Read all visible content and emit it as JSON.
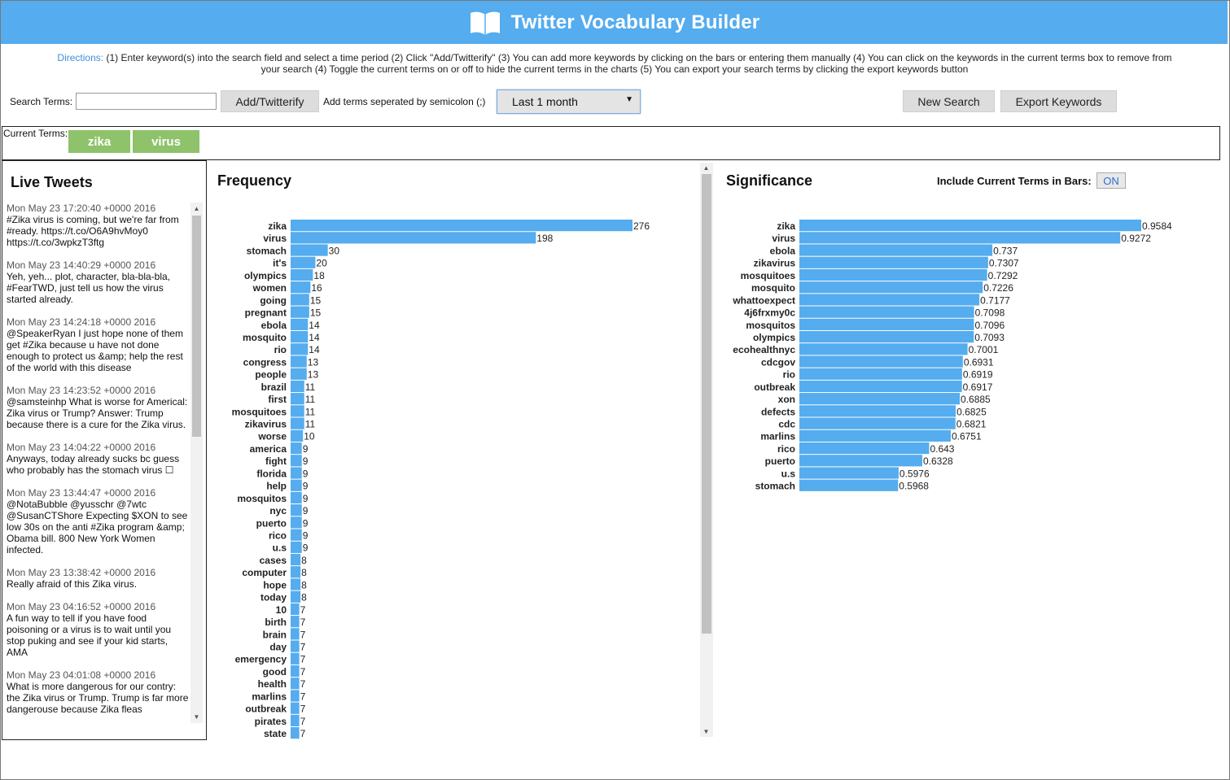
{
  "header": {
    "title": "Twitter Vocabulary Builder",
    "icon": "book-icon"
  },
  "directions": {
    "label": "Directions:",
    "text": " (1) Enter keyword(s) into the search field and select a time period (2) Click \"Add/Twitterify\" (3) You can add more keywords by clicking on the bars or entering them manually (4) You can click on the keywords in the current terms box to remove from your search (4) Toggle the current terms on or off to hide the current terms in the charts (5) You can export your search terms by clicking the export keywords button"
  },
  "search": {
    "label": "Search Terms:",
    "value": "",
    "add_button": "Add/Twitterify",
    "hint": "Add terms seperated by semicolon (;)",
    "period": "Last 1 month",
    "new_search_button": "New Search",
    "export_button": "Export Keywords"
  },
  "current_terms": {
    "label": "Current Terms:",
    "terms": [
      "zika",
      "virus"
    ]
  },
  "live_tweets": {
    "title": "Live Tweets",
    "tweets": [
      {
        "time": "Mon May 23 17:20:40 +0000 2016",
        "text": "#Zika virus is coming, but we're far from #ready. https://t.co/O6A9hvMoy0 https://t.co/3wpkzT3ftg"
      },
      {
        "time": "Mon May 23 14:40:29 +0000 2016",
        "text": "Yeh, yeh... plot, character, bla-bla-bla, #FearTWD, just tell us how the virus started already."
      },
      {
        "time": "Mon May 23 14:24:18 +0000 2016",
        "text": "@SpeakerRyan I just hope none of them get #Zika because u have not done enough to protect us &amp; help the rest of the world with this disease"
      },
      {
        "time": "Mon May 23 14:23:52 +0000 2016",
        "text": "@samsteinhp What is worse for Americal: Zika virus or Trump? Answer: Trump because there is a cure for the Zika virus."
      },
      {
        "time": "Mon May 23 14:04:22 +0000 2016",
        "text": "Anyways, today already sucks bc guess who probably has the stomach virus ☐"
      },
      {
        "time": "Mon May 23 13:44:47 +0000 2016",
        "text": "@NotaBubble @yusschr @7wtc @SusanCTShore Expecting $XON to see low 30s on the anti #Zika program &amp; Obama bill. 800 New York Women infected."
      },
      {
        "time": "Mon May 23 13:38:42 +0000 2016",
        "text": "Really afraid of this Zika virus."
      },
      {
        "time": "Mon May 23 04:16:52 +0000 2016",
        "text": "A fun way to tell if you have food poisoning or a virus is to wait until you stop puking and see if your kid starts, AMA"
      },
      {
        "time": "Mon May 23 04:01:08 +0000 2016",
        "text": "What is more dangerous for our contry: the Zika virus or Trump. Trump is far more dangerouse because Zika fleas"
      }
    ]
  },
  "toggle": {
    "label": "Include Current Terms in Bars:",
    "value": "ON"
  },
  "chart_data": [
    {
      "type": "bar",
      "title": "Frequency",
      "orientation": "horizontal",
      "categories": [
        "zika",
        "virus",
        "stomach",
        "it's",
        "olympics",
        "women",
        "going",
        "pregnant",
        "ebola",
        "mosquito",
        "rio",
        "congress",
        "people",
        "brazil",
        "first",
        "mosquitoes",
        "zikavirus",
        "worse",
        "america",
        "fight",
        "florida",
        "help",
        "mosquitos",
        "nyc",
        "puerto",
        "rico",
        "u.s",
        "cases",
        "computer",
        "hope",
        "today",
        "10",
        "birth",
        "brain",
        "day",
        "emergency",
        "good",
        "health",
        "marlins",
        "outbreak",
        "pirates",
        "state"
      ],
      "values": [
        276,
        198,
        30,
        20,
        18,
        16,
        15,
        15,
        14,
        14,
        14,
        13,
        13,
        11,
        11,
        11,
        11,
        10,
        9,
        9,
        9,
        9,
        9,
        9,
        9,
        9,
        9,
        8,
        8,
        8,
        8,
        7,
        7,
        7,
        7,
        7,
        7,
        7,
        7,
        7,
        7,
        7
      ],
      "color": "#55acee"
    },
    {
      "type": "bar",
      "title": "Significance",
      "orientation": "horizontal",
      "categories": [
        "zika",
        "virus",
        "ebola",
        "zikavirus",
        "mosquitoes",
        "mosquito",
        "whattoexpect",
        "4j6frxmy0c",
        "mosquitos",
        "olympics",
        "ecohealthnyc",
        "cdcgov",
        "rio",
        "outbreak",
        "xon",
        "defects",
        "cdc",
        "marlins",
        "rico",
        "puerto",
        "u.s",
        "stomach"
      ],
      "labels": [
        "0.9584",
        "0.9272",
        "0.737",
        "0.7307",
        "0.7292",
        "0.7226",
        "0.7177",
        "0.7098",
        "0.7096",
        "0.7093",
        "0.7001",
        "0.6931",
        "0.6919",
        "0.6917",
        "0.6885",
        "0.6825",
        "0.6821",
        "0.6751",
        "0.643",
        "0.6328",
        "0.5976",
        "0.5968"
      ],
      "values": [
        0.9584,
        0.9272,
        0.737,
        0.7307,
        0.7292,
        0.7226,
        0.7177,
        0.7098,
        0.7096,
        0.7093,
        0.7001,
        0.6931,
        0.6919,
        0.6917,
        0.6885,
        0.6825,
        0.6821,
        0.6751,
        0.643,
        0.6328,
        0.5976,
        0.5968
      ],
      "color": "#55acee"
    }
  ]
}
